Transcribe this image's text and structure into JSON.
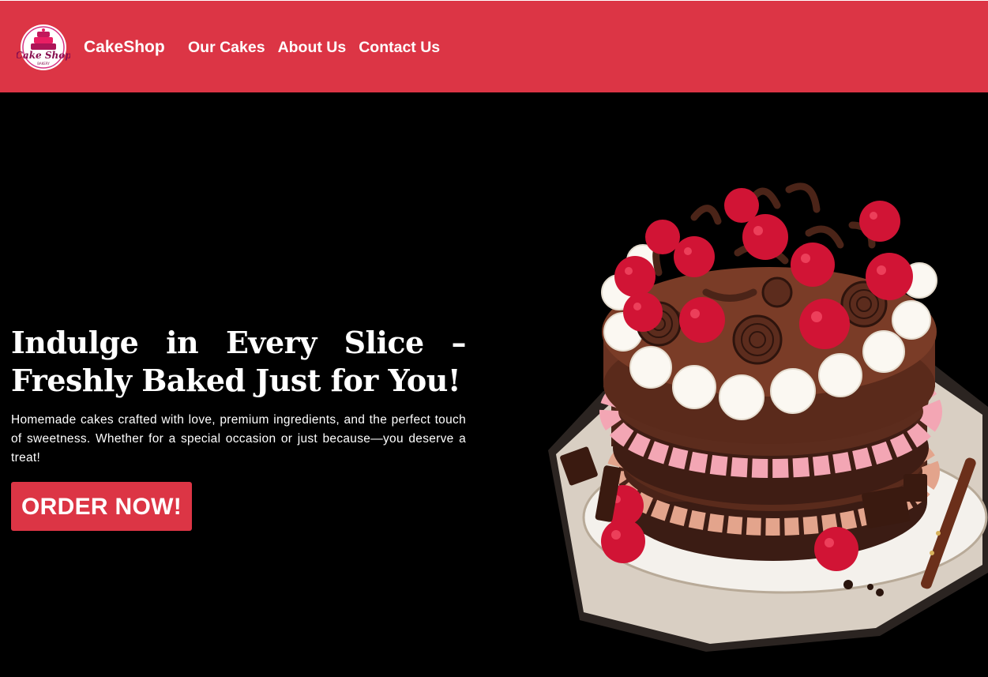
{
  "navbar": {
    "brand": "CakeShop",
    "logo_text": "Cake Shop",
    "logo_subtext": "BAKERY",
    "links": [
      "Our Cakes",
      "About Us",
      "Contact Us"
    ],
    "background": "#dc3545"
  },
  "hero": {
    "headline": "Indulge in Every Slice – Freshly Baked Just for You!",
    "subtext": "Homemade cakes crafted with love, premium ingredients, and the perfect touch of sweetness. Whether for a special occasion or just because—you deserve a treat!",
    "cta_label": "ORDER NOW!",
    "image_icon": "chocolate-raspberry-cake"
  },
  "colors": {
    "accent": "#dc3545",
    "hero_bg": "#000000",
    "text": "#ffffff"
  }
}
